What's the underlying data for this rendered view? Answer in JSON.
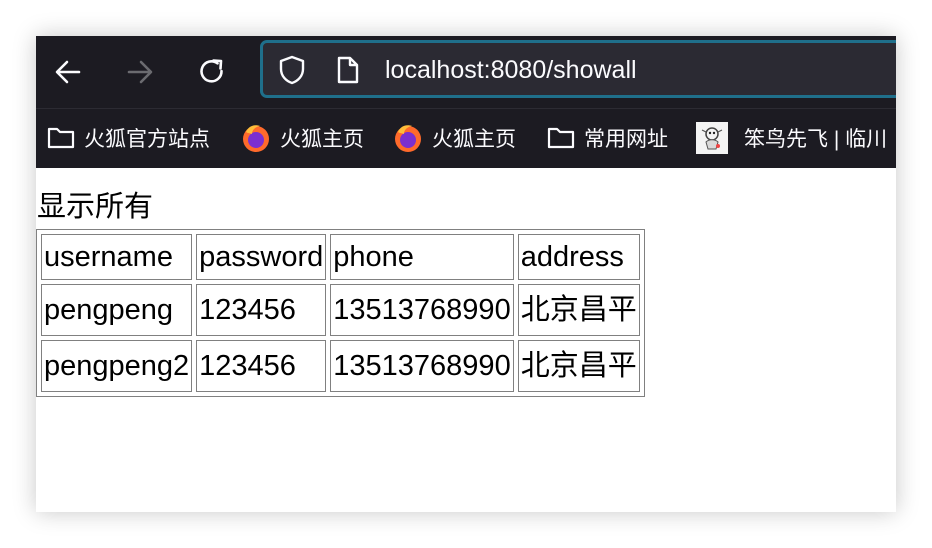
{
  "browser": {
    "url": "localhost:8080/showall",
    "bookmarks": [
      {
        "label": "火狐官方站点",
        "icon": "folder-icon"
      },
      {
        "label": "火狐主页",
        "icon": "firefox-icon"
      },
      {
        "label": "火狐主页",
        "icon": "firefox-icon"
      },
      {
        "label": "常用网址",
        "icon": "folder-icon"
      },
      {
        "label": "笨鸟先飞 | 临川",
        "icon": "bird-favicon"
      }
    ],
    "colors": {
      "toolbar_bg": "#1c1b22",
      "url_bar_bg": "#2b2a33",
      "url_bar_focus": "#1f6f8b",
      "text": "#fbfbfe",
      "disabled_icon": "#6b6b70"
    }
  },
  "page": {
    "title": "显示所有",
    "table": {
      "headers": [
        "username",
        "password",
        "phone",
        "address"
      ],
      "rows": [
        [
          "pengpeng",
          "123456",
          "13513768990",
          "北京昌平"
        ],
        [
          "pengpeng2",
          "123456",
          "13513768990",
          "北京昌平"
        ]
      ]
    }
  }
}
